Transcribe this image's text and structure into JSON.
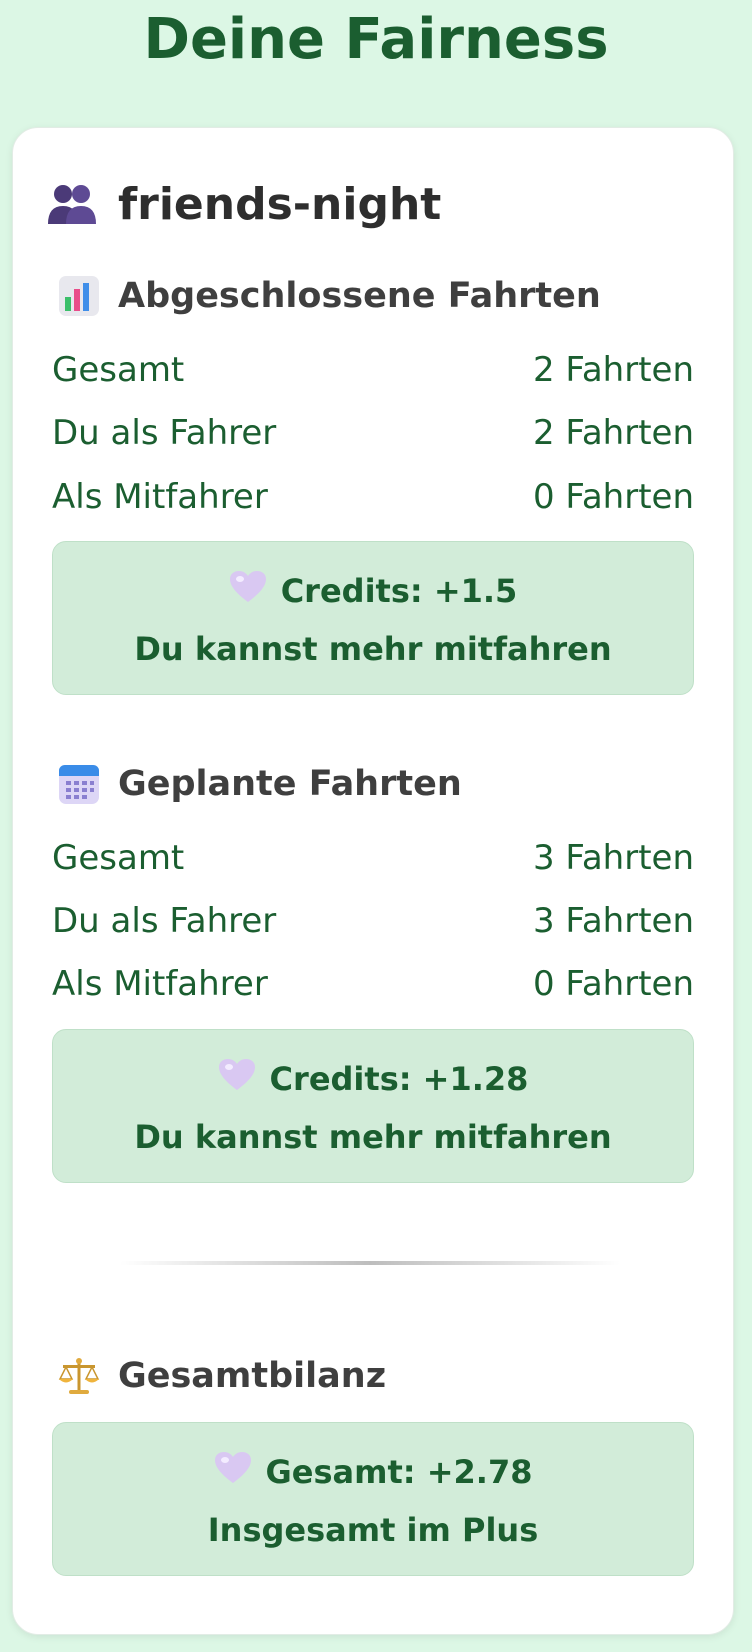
{
  "page": {
    "title": "Deine Fairness"
  },
  "group": {
    "name": "friends-night",
    "icon": "people-icon"
  },
  "completed": {
    "title": "Abgeschlossene Fahrten",
    "icon": "bar-chart-icon",
    "rows": [
      {
        "label": "Gesamt",
        "value": "2 Fahrten"
      },
      {
        "label": "Du als Fahrer",
        "value": "2 Fahrten"
      },
      {
        "label": "Als Mitfahrer",
        "value": "0 Fahrten"
      }
    ],
    "credits": "Credits: +1.5",
    "message": "Du kannst mehr mitfahren"
  },
  "planned": {
    "title": "Geplante Fahrten",
    "icon": "calendar-icon",
    "rows": [
      {
        "label": "Gesamt",
        "value": "3 Fahrten"
      },
      {
        "label": "Du als Fahrer",
        "value": "3 Fahrten"
      },
      {
        "label": "Als Mitfahrer",
        "value": "0 Fahrten"
      }
    ],
    "credits": "Credits: +1.28",
    "message": "Du kannst mehr mitfahren"
  },
  "total": {
    "title": "Gesamtbilanz",
    "icon": "scales-icon",
    "credits": "Gesamt: +2.78",
    "message": "Insgesamt im Plus"
  },
  "colors": {
    "background": "#dcf7e5",
    "accent": "#1b5e30",
    "box": "#d2ecd9",
    "heart": "#d9c8f2"
  }
}
